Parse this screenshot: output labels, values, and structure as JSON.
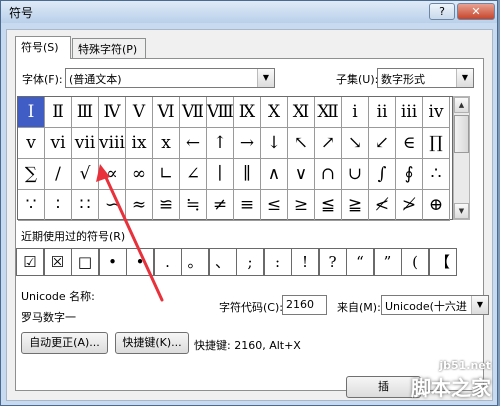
{
  "window": {
    "title": "符号",
    "help": "?",
    "close": "✕"
  },
  "tabs": [
    {
      "label": "符号(S)"
    },
    {
      "label": "特殊字符(P)"
    }
  ],
  "font": {
    "label": "字体(F):",
    "value": "(普通文本)"
  },
  "subset": {
    "label": "子集(U):",
    "value": "数字形式"
  },
  "symbols": [
    [
      "Ⅰ",
      "Ⅱ",
      "Ⅲ",
      "Ⅳ",
      "Ⅴ",
      "Ⅵ",
      "Ⅶ",
      "Ⅷ",
      "Ⅸ",
      "Ⅹ",
      "Ⅺ",
      "Ⅻ",
      "ⅰ",
      "ⅱ",
      "ⅲ",
      "ⅳ"
    ],
    [
      "ⅴ",
      "ⅵ",
      "ⅶ",
      "ⅷ",
      "ⅸ",
      "ⅹ",
      "←",
      "↑",
      "→",
      "↓",
      "↖",
      "↗",
      "↘",
      "↙",
      "∈",
      "∏"
    ],
    [
      "∑",
      "∕",
      "√",
      "∝",
      "∞",
      "∟",
      "∠",
      "∣",
      "∥",
      "∧",
      "∨",
      "∩",
      "∪",
      "∫",
      "∮",
      "∴"
    ],
    [
      "∵",
      "∶",
      "∷",
      "∽",
      "≈",
      "≌",
      "≒",
      "≠",
      "≡",
      "≤",
      "≥",
      "≦",
      "≧",
      "≮",
      "≯",
      "⊕"
    ]
  ],
  "selected_symbol": "Ⅰ",
  "recent": {
    "label": "近期使用过的符号(R)",
    "items": [
      "☑",
      "☒",
      "□",
      "•",
      "•",
      ".",
      "。",
      "、",
      ";",
      ":",
      "!",
      "?",
      "“",
      "”",
      "(",
      "【"
    ]
  },
  "unicode_name": {
    "label": "Unicode 名称:",
    "value": "罗马数字一"
  },
  "char_code": {
    "label": "字符代码(C):",
    "value": "2160"
  },
  "from": {
    "label": "来自(M):",
    "value": "Unicode(十六进"
  },
  "autocorrect_button": "自动更正(A)...",
  "shortcut_button": "快捷键(K)...",
  "shortcut_text": "快捷键: 2160, Alt+X",
  "insert_button": "插",
  "watermark": {
    "url": "jb51.net",
    "name": "脚本之家"
  },
  "colors": {
    "selection": "#3f5dc4",
    "annotation_arrow": "#e8313a"
  }
}
